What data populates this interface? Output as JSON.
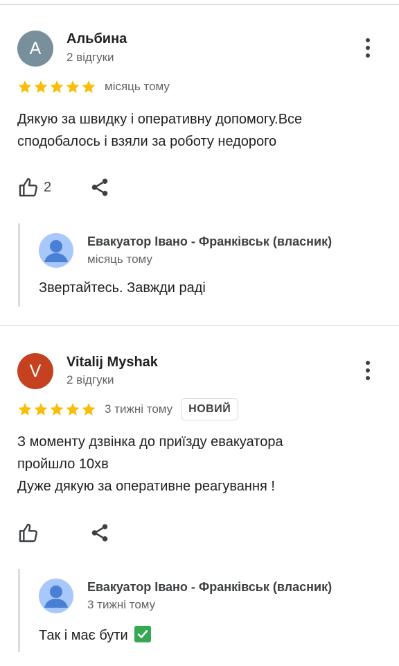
{
  "reviews": [
    {
      "initial": "A",
      "avatar_color": "#78909c",
      "author": "Альбина",
      "meta": "2 відгуки",
      "rating": 5,
      "date": "місяць тому",
      "badge": "",
      "text": "Дякую за швидку і оперативну допомогу.Все\nсподобалось і взяли за роботу недорого",
      "likes": "2",
      "reply": {
        "owner": "Евакуатор Івано - Франківськ (власник)",
        "date": "місяць тому",
        "text": "Звертайтесь. Завжди раді",
        "emoji": ""
      }
    },
    {
      "initial": "V",
      "avatar_color": "#c5411f",
      "author": "Vitalij Myshak",
      "meta": "2 відгуки",
      "rating": 5,
      "date": "3 тижні тому",
      "badge": "НОВИЙ",
      "text": "З моменту дзвінка до приїзду  евакуатора\nпройшло 10хв\nДуже дякую за оперативне реагування !",
      "likes": "",
      "reply": {
        "owner": "Евакуатор Івано - Франківськ (власник)",
        "date": "3 тижні тому",
        "text": "Так і має бути",
        "emoji": "check-mark-button"
      }
    }
  ],
  "colors": {
    "star": "#fbbc04",
    "divider": "#dadce0",
    "owner_avatar": "#a8c7fa",
    "owner_avatar_figure": "#4a7fd6"
  },
  "icons": {
    "menu": "more-vert-icon",
    "like": "thumb-up-icon",
    "share": "share-icon"
  }
}
